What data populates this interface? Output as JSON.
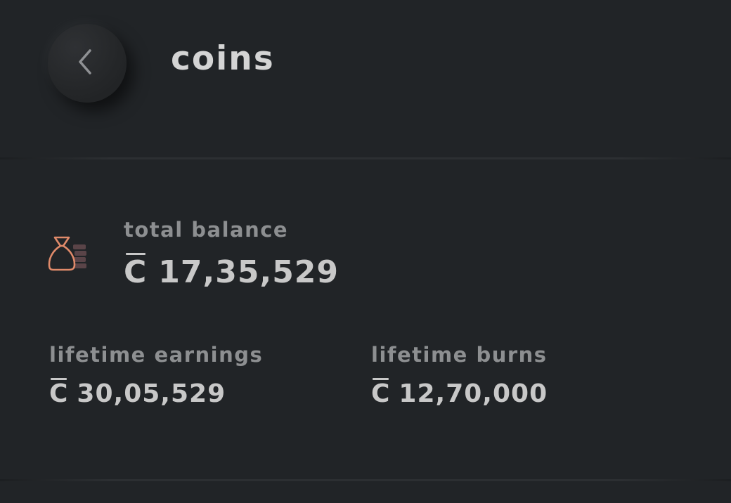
{
  "header": {
    "title": "coins",
    "back_icon": "chevron-left-icon"
  },
  "balance": {
    "icon": "coin-bag-icon",
    "label": "total balance",
    "currency_symbol": "C",
    "amount": "17,35,529"
  },
  "stats": {
    "earnings": {
      "label": "lifetime earnings",
      "currency_symbol": "C",
      "amount": "30,05,529"
    },
    "burns": {
      "label": "lifetime burns",
      "currency_symbol": "C",
      "amount": "12,70,000"
    }
  },
  "colors": {
    "background": "#212427",
    "accent": "#e08a6a",
    "label": "#8d8f91",
    "value": "#c8c8c8"
  }
}
